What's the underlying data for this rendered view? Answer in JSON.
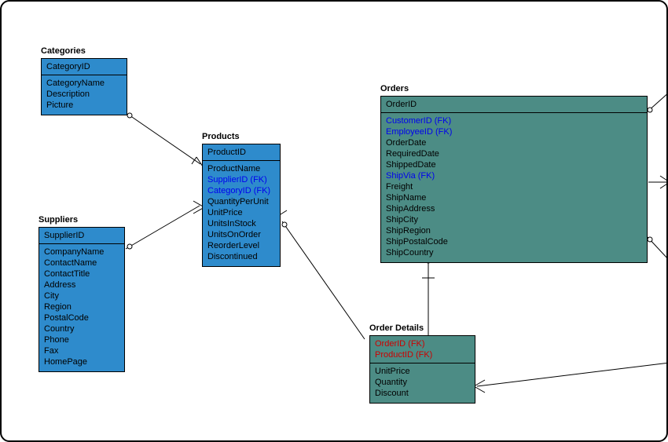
{
  "entities": {
    "categories": {
      "title": "Categories",
      "pk": "CategoryID",
      "columns": [
        {
          "name": "CategoryName"
        },
        {
          "name": "Description"
        },
        {
          "name": "Picture"
        }
      ]
    },
    "products": {
      "title": "Products",
      "pk": "ProductID",
      "columns": [
        {
          "name": "ProductName"
        },
        {
          "name": "SupplierID (FK)",
          "fk": true
        },
        {
          "name": "CategoryID (FK)",
          "fk": true
        },
        {
          "name": "QuantityPerUnit"
        },
        {
          "name": "UnitPrice"
        },
        {
          "name": "UnitsInStock"
        },
        {
          "name": "UnitsOnOrder"
        },
        {
          "name": "ReorderLevel"
        },
        {
          "name": "Discontinued"
        }
      ]
    },
    "suppliers": {
      "title": "Suppliers",
      "pk": "SupplierID",
      "columns": [
        {
          "name": "CompanyName"
        },
        {
          "name": "ContactName"
        },
        {
          "name": "ContactTitle"
        },
        {
          "name": "Address"
        },
        {
          "name": "City"
        },
        {
          "name": "Region"
        },
        {
          "name": "PostalCode"
        },
        {
          "name": "Country"
        },
        {
          "name": "Phone"
        },
        {
          "name": "Fax"
        },
        {
          "name": "HomePage"
        }
      ]
    },
    "orders": {
      "title": "Orders",
      "pk": "OrderID",
      "columns": [
        {
          "name": "CustomerID (FK)",
          "fk": true
        },
        {
          "name": "EmployeeID (FK)",
          "fk": true
        },
        {
          "name": "OrderDate"
        },
        {
          "name": "RequiredDate"
        },
        {
          "name": "ShippedDate"
        },
        {
          "name": "ShipVia (FK)",
          "fk": true
        },
        {
          "name": "Freight"
        },
        {
          "name": "ShipName"
        },
        {
          "name": "ShipAddress"
        },
        {
          "name": "ShipCity"
        },
        {
          "name": "ShipRegion"
        },
        {
          "name": "ShipPostalCode"
        },
        {
          "name": "ShipCountry"
        }
      ]
    },
    "orderdetails": {
      "title": "Order Details",
      "pk_rows": [
        {
          "name": "OrderID (FK)"
        },
        {
          "name": "ProductID (FK)"
        }
      ],
      "columns": [
        {
          "name": "UnitPrice"
        },
        {
          "name": "Quantity"
        },
        {
          "name": "Discount"
        }
      ]
    }
  },
  "chart_data": {
    "type": "diagram",
    "diagram_type": "entity-relationship",
    "entities": [
      {
        "name": "Categories",
        "pk": [
          "CategoryID"
        ],
        "columns": [
          "CategoryName",
          "Description",
          "Picture"
        ]
      },
      {
        "name": "Products",
        "pk": [
          "ProductID"
        ],
        "columns": [
          "ProductName",
          "SupplierID (FK)",
          "CategoryID (FK)",
          "QuantityPerUnit",
          "UnitPrice",
          "UnitsInStock",
          "UnitsOnOrder",
          "ReorderLevel",
          "Discontinued"
        ]
      },
      {
        "name": "Suppliers",
        "pk": [
          "SupplierID"
        ],
        "columns": [
          "CompanyName",
          "ContactName",
          "ContactTitle",
          "Address",
          "City",
          "Region",
          "PostalCode",
          "Country",
          "Phone",
          "Fax",
          "HomePage"
        ]
      },
      {
        "name": "Orders",
        "pk": [
          "OrderID"
        ],
        "columns": [
          "CustomerID (FK)",
          "EmployeeID (FK)",
          "OrderDate",
          "RequiredDate",
          "ShippedDate",
          "ShipVia (FK)",
          "Freight",
          "ShipName",
          "ShipAddress",
          "ShipCity",
          "ShipRegion",
          "ShipPostalCode",
          "ShipCountry"
        ]
      },
      {
        "name": "Order Details",
        "pk": [
          "OrderID (FK)",
          "ProductID (FK)"
        ],
        "columns": [
          "UnitPrice",
          "Quantity",
          "Discount"
        ]
      }
    ],
    "relationships": [
      {
        "from": "Categories",
        "to": "Products",
        "type": "one-to-many"
      },
      {
        "from": "Suppliers",
        "to": "Products",
        "type": "one-to-many"
      },
      {
        "from": "Products",
        "to": "Order Details",
        "type": "one-to-many"
      },
      {
        "from": "Orders",
        "to": "Order Details",
        "type": "one-to-many"
      }
    ]
  }
}
